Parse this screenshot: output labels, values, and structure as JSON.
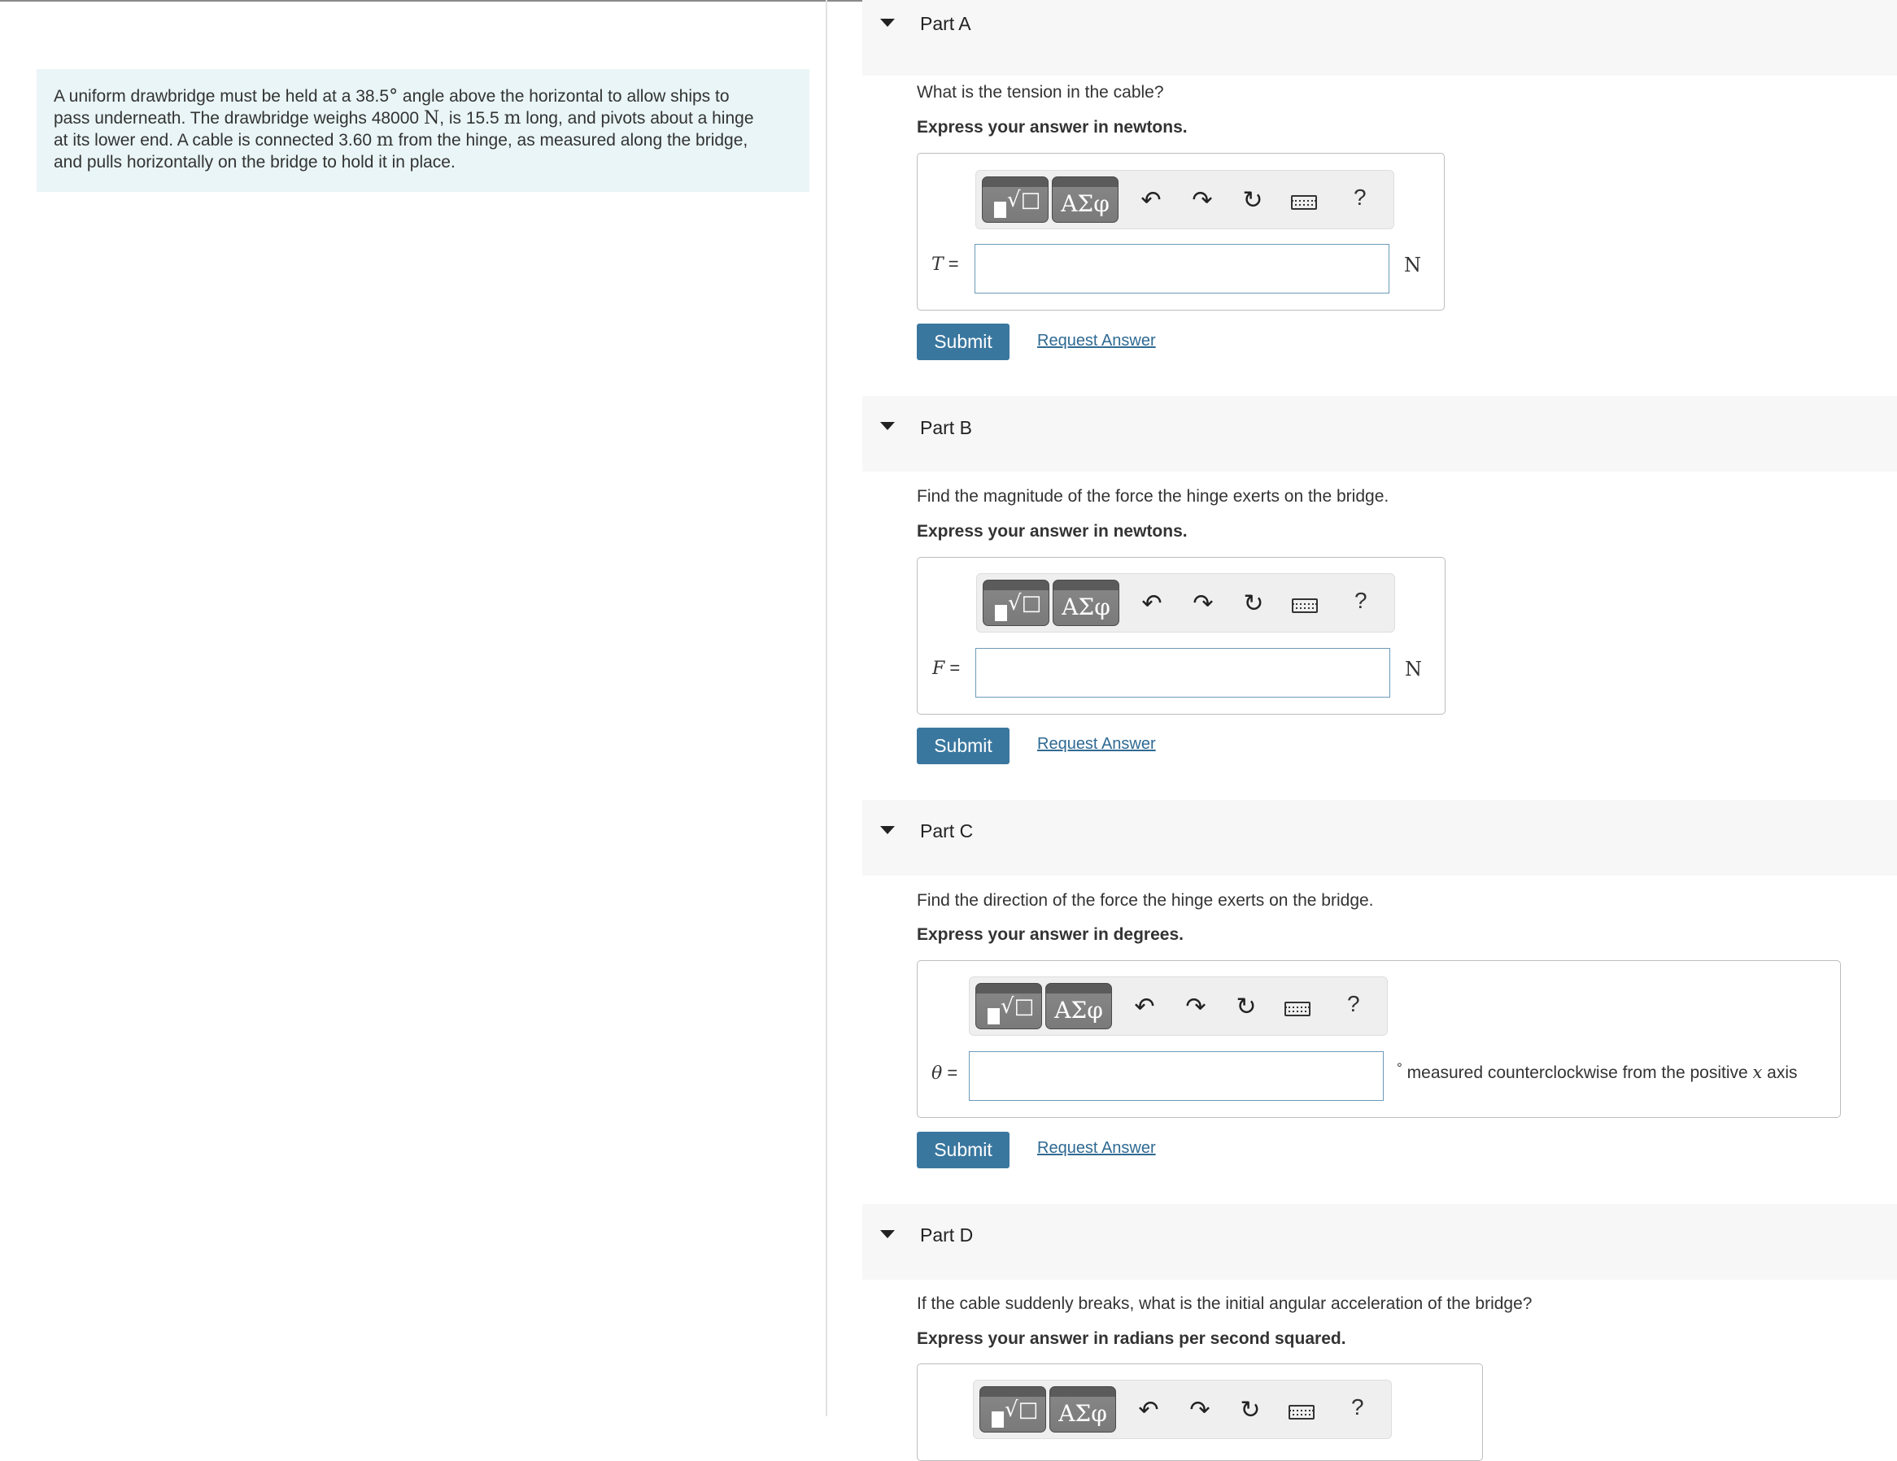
{
  "problem": {
    "line1_a": "A uniform drawbridge must be held at a 38.5",
    "deg": "°",
    "line1_b": " angle above the horizontal to allow ships to",
    "line2_a": "pass underneath. The drawbridge weighs 48000 ",
    "unit_N": "N",
    "line2_b": ", is 15.5 ",
    "unit_m": "m",
    "line2_c": " long, and pivots about a hinge",
    "line3_a": "at its lower end. A cable is connected 3.60 ",
    "line3_b": " from the hinge, as measured along the bridge,",
    "line4": "and pulls horizontally on the bridge to hold it in place."
  },
  "toolbar": {
    "templates_icon": "√□",
    "greek_label": "ΑΣφ",
    "undo_icon": "↶",
    "redo_icon": "↷",
    "reset_icon": "↻",
    "help": "?"
  },
  "parts": [
    {
      "title": "Part A",
      "question": "What is the tension in the cable?",
      "instruction": "Express your answer in newtons.",
      "variable": "T",
      "equals": " =",
      "unit": "N",
      "submit": "Submit",
      "request": "Request Answer"
    },
    {
      "title": "Part B",
      "question": "Find the magnitude of the force the hinge exerts on the bridge.",
      "instruction": "Express your answer in newtons.",
      "variable": "F",
      "equals": " =",
      "unit": "N",
      "submit": "Submit",
      "request": "Request Answer"
    },
    {
      "title": "Part C",
      "question": "Find the direction of the force the hinge exerts on the bridge.",
      "instruction": "Express your answer in degrees.",
      "variable": "θ",
      "equals": " =",
      "unit_deg": "°",
      "unit_text_a": " measured counterclockwise from the positive ",
      "unit_var": "x",
      "unit_text_b": " axis",
      "submit": "Submit",
      "request": "Request Answer"
    },
    {
      "title": "Part D",
      "question": "If the cable suddenly breaks, what is the initial angular acceleration of the bridge?",
      "instruction": "Express your answer in radians per second squared."
    }
  ]
}
